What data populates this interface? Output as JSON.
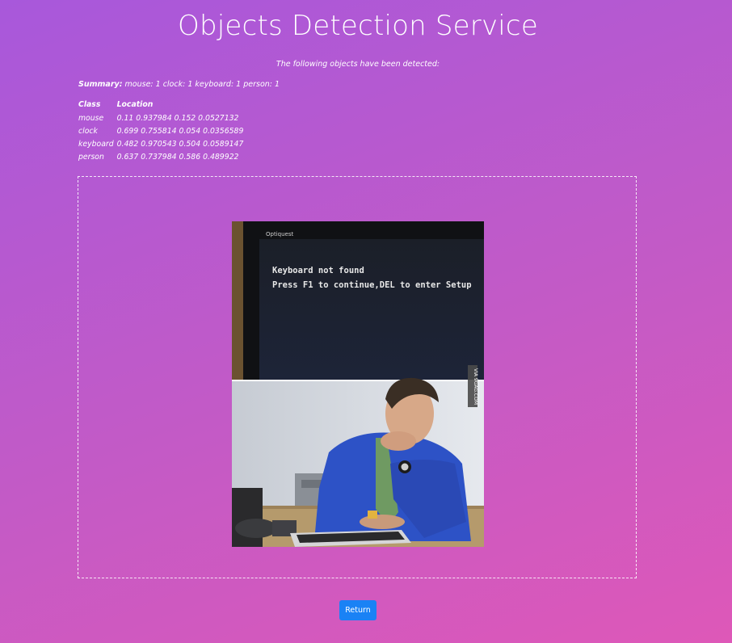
{
  "header": {
    "title": "Objects Detection Service"
  },
  "intro": {
    "text": "The following objects have been detected:"
  },
  "summary": {
    "label": "Summary:",
    "text": "mouse: 1 clock: 1 keyboard: 1 person: 1"
  },
  "table": {
    "headers": [
      "Class",
      "Location"
    ],
    "rows": [
      {
        "cls": "mouse",
        "location": "0.11 0.937984 0.152 0.0527132"
      },
      {
        "cls": "clock",
        "location": "0.699 0.755814 0.054 0.0356589"
      },
      {
        "cls": "keyboard",
        "location": "0.482 0.970543 0.504 0.0589147"
      },
      {
        "cls": "person",
        "location": "0.637 0.737984 0.586 0.489922"
      }
    ]
  },
  "image": {
    "screen_line1": "Keyboard not found",
    "screen_line2": "Press F1 to continue,DEL to enter Setup",
    "monitor_brand": "Optiquest",
    "watermark": "VIA 9GAG.COM"
  },
  "actions": {
    "return_label": "Return"
  },
  "colors": {
    "button": "#1a82f5",
    "background_start": "#a858db",
    "background_end": "#de58b8"
  }
}
